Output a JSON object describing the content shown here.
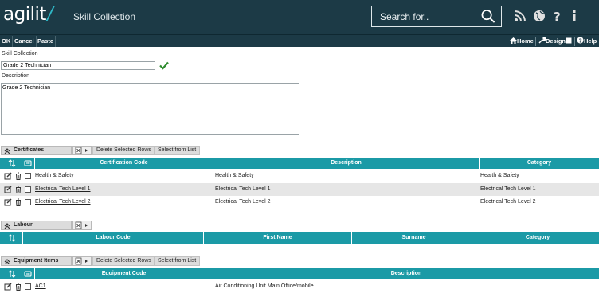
{
  "header": {
    "logo": "agilit",
    "title": "Skill Collection",
    "search_placeholder": "Search for.."
  },
  "toolbar": {
    "ok": "OK",
    "cancel": "Cancel",
    "paste": "Paste",
    "home": "Home",
    "design": "Design",
    "help": "Help"
  },
  "form": {
    "name_label": "Skill Collection",
    "name_value": "Grade 2 Technician",
    "description_label": "Description",
    "description_value": "Grade 2 Technician"
  },
  "certificates": {
    "title": "Certificates",
    "delete_label": "Delete Selected Rows",
    "select_label": "Select from List",
    "columns": [
      "Certification Code",
      "Description",
      "Category"
    ],
    "rows": [
      {
        "code": "Health & Safety",
        "description": "Health & Safety",
        "category": "Health & Safety"
      },
      {
        "code": "Electrical Tech Level 1",
        "description": "Electrical Tech Level 1",
        "category": "Electrical Tech Level 1"
      },
      {
        "code": "Electrical Tech Level 2",
        "description": "Electrical Tech Level 2",
        "category": "Electrical Tech Level 2"
      }
    ]
  },
  "labour": {
    "title": "Labour",
    "columns": [
      "Labour Code",
      "First Name",
      "Surname",
      "Category"
    ]
  },
  "equipment": {
    "title": "Equipment Items",
    "delete_label": "Delete Selected Rows",
    "select_label": "Select from List",
    "columns": [
      "Equipment Code",
      "Description"
    ],
    "rows": [
      {
        "code": "AC1",
        "description": "Air Conditioning Unit Main Office/mobile"
      }
    ]
  },
  "colors": {
    "header_bg": "#1c3a46",
    "table_header": "#1b9aa6",
    "accent": "#2fb8c7",
    "ok_check": "#2e8b2e"
  }
}
